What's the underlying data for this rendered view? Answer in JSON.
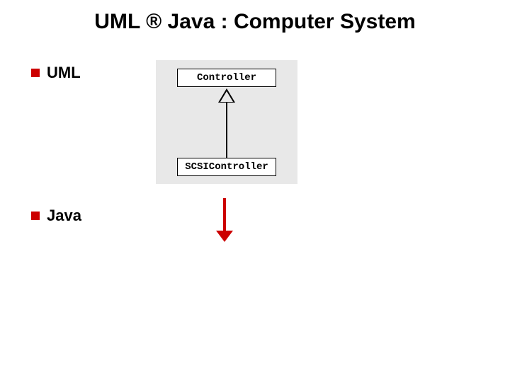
{
  "title_parts": {
    "left": "UML",
    "arrow": "®",
    "right": "Java : Computer System"
  },
  "bullets": {
    "uml": "UML",
    "java": "Java"
  },
  "uml_diagram": {
    "superclass": "Controller",
    "subclass": "SCSIController",
    "relation": "generalization"
  },
  "colors": {
    "accent": "#cc0000",
    "panel": "#e8e8e8"
  }
}
